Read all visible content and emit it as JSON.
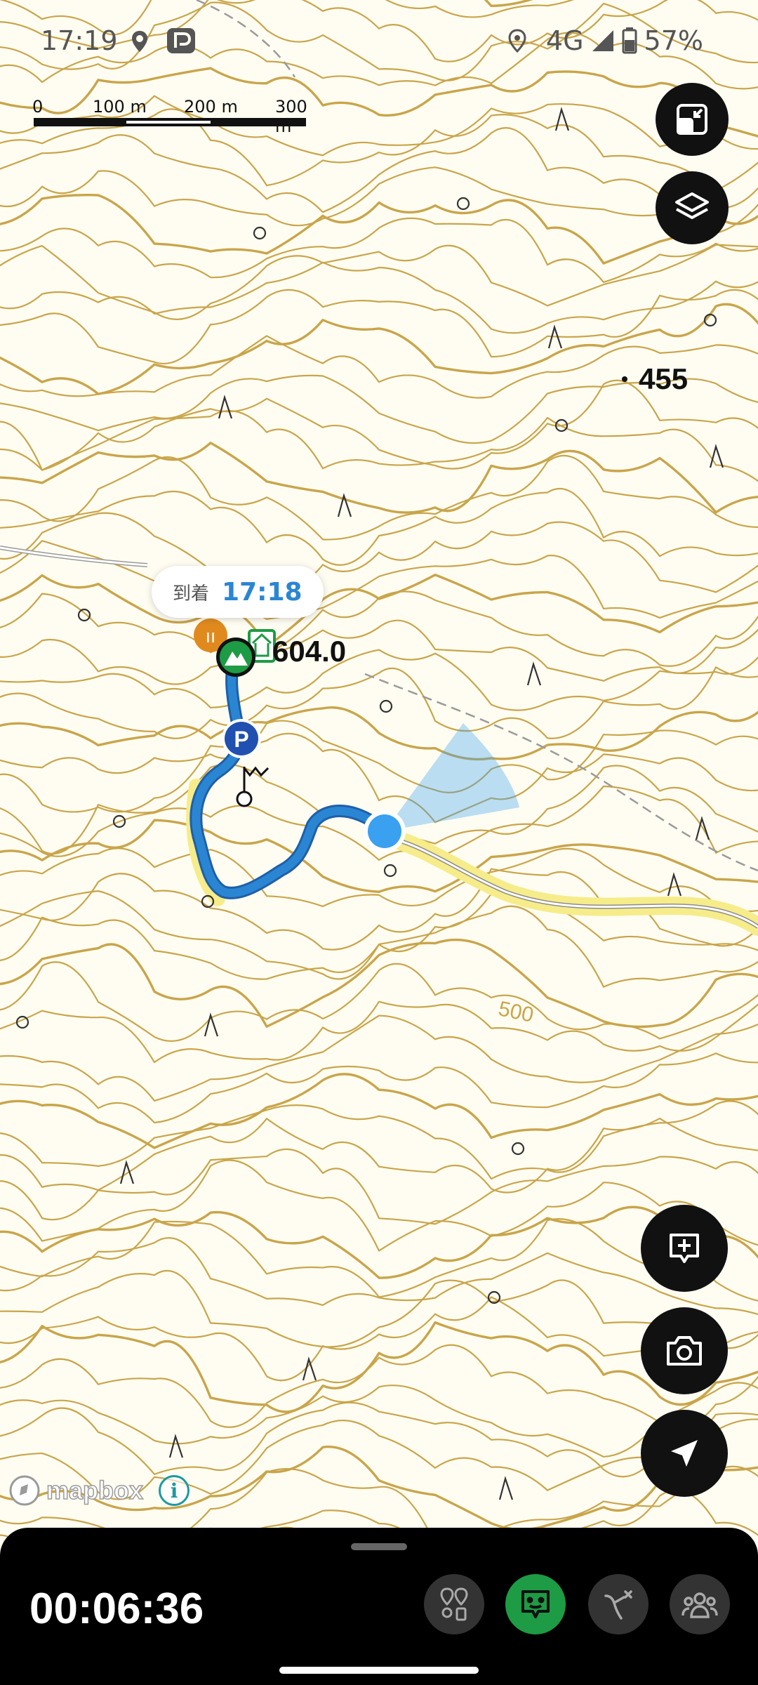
{
  "status_bar": {
    "time": "17:19",
    "network": "4G",
    "battery": "57%",
    "icons": [
      "location-pin-icon",
      "app-notification-icon",
      "location-icon",
      "signal-icon",
      "battery-icon"
    ]
  },
  "scale_bar": {
    "labels": [
      "0",
      "100 m",
      "200 m",
      "300 m"
    ]
  },
  "map": {
    "arrival": {
      "label": "到着",
      "time": "17:18"
    },
    "summit_elevation": "604.0",
    "spot_elevation": "455",
    "contour_label": "500",
    "attribution": "mapbox",
    "colors": {
      "background": "#fffdf2",
      "contour": "#c9a54a",
      "track": "#2a86d3",
      "current_location": "#3aa0f0",
      "trail_highlight": "#f6ec8a",
      "summit_marker": "#1d9b45"
    }
  },
  "right_buttons": [
    "fit-screen-icon",
    "layers-icon",
    "add-memo-icon",
    "camera-icon",
    "navigation-arrow-icon"
  ],
  "bottom_panel": {
    "elapsed_time": "00:06:36",
    "tools": [
      "checkpoints-icon",
      "community-chat-icon",
      "route-split-icon",
      "group-icon"
    ],
    "active_tool": "community-chat-icon"
  }
}
